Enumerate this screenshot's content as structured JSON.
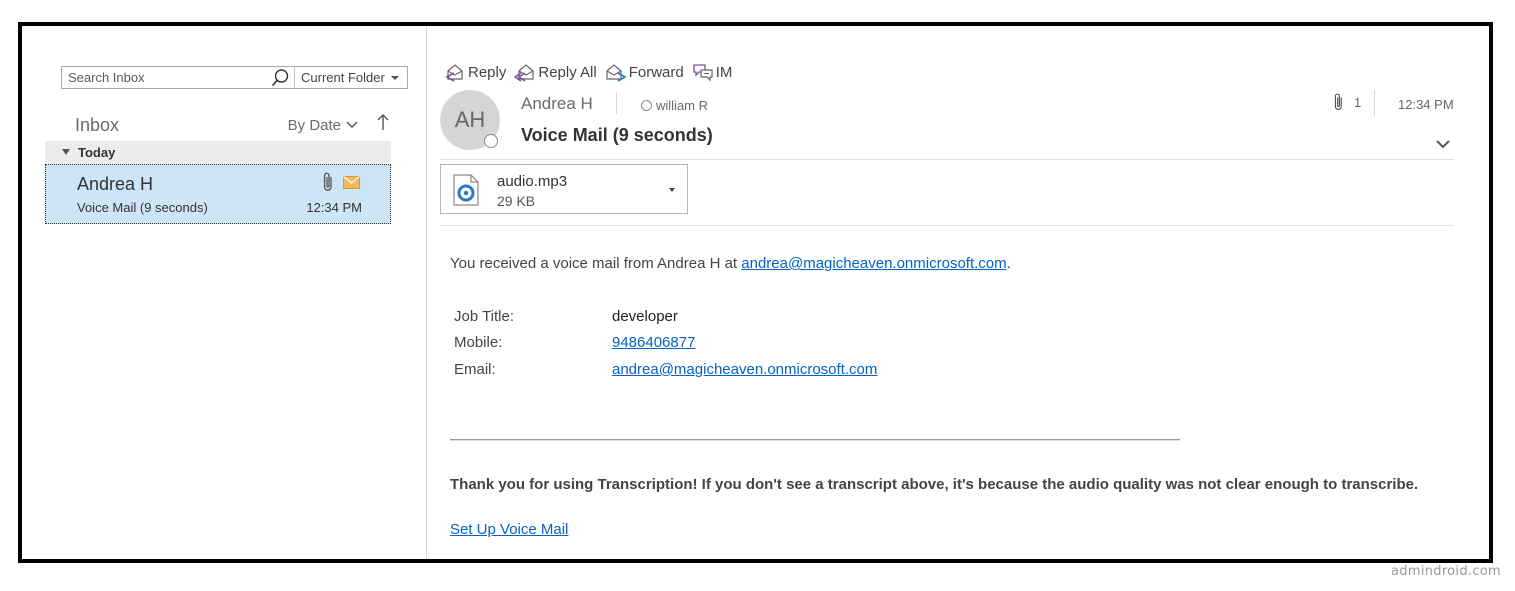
{
  "search": {
    "placeholder": "Search Inbox",
    "scope": "Current Folder"
  },
  "folder": {
    "title": "Inbox",
    "sort_label": "By Date",
    "sort_direction_icon": "arrow-up-icon"
  },
  "group": {
    "label": "Today"
  },
  "message_list": [
    {
      "sender": "Andrea H",
      "subject": "Voice Mail (9 seconds)",
      "time": "12:34 PM",
      "has_attachment": true,
      "unread_icon": "envelope-icon"
    }
  ],
  "actions": [
    {
      "label": "Reply",
      "icon": "reply-icon"
    },
    {
      "label": "Reply All",
      "icon": "reply-all-icon"
    },
    {
      "label": "Forward",
      "icon": "forward-icon"
    },
    {
      "label": "IM",
      "icon": "im-icon"
    }
  ],
  "message": {
    "avatar_initials": "AH",
    "from": "Andrea H",
    "to": "william R",
    "subject": "Voice Mail (9 seconds)",
    "attachment_count": "1",
    "time": "12:34 PM",
    "attachment": {
      "name": "audio.mp3",
      "size": "29 KB"
    },
    "body": {
      "intro_text": "You received a voice mail from Andrea H at ",
      "intro_email": "andrea@magicheaven.onmicrosoft.com",
      "intro_end": ".",
      "details": [
        {
          "label": "Job Title:",
          "value": "developer",
          "is_link": false
        },
        {
          "label": "Mobile:",
          "value": "9486406877",
          "is_link": true
        },
        {
          "label": "Email:",
          "value": "andrea@magicheaven.onmicrosoft.com",
          "is_link": true
        }
      ],
      "thanks": "Thank you for using Transcription! If you don't see a transcript above, it's because the audio quality was not clear enough to transcribe.",
      "setup_link": "Set Up Voice Mail"
    }
  },
  "watermark": "admindroid.com",
  "colors": {
    "selected_row": "#cde6f7",
    "link": "#0563c1",
    "envelope": "#f0b860",
    "accent_purple": "#7a4fa0",
    "accent_blue": "#2b78c5"
  }
}
